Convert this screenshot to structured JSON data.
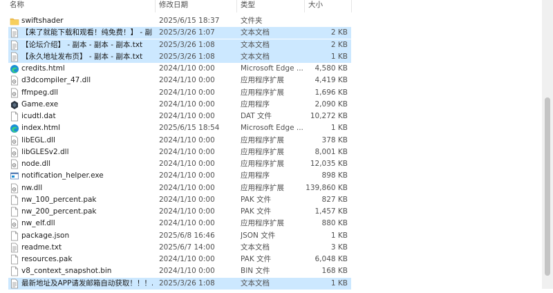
{
  "columns": {
    "name": "名称",
    "date": "修改日期",
    "type": "类型",
    "size": "大小"
  },
  "rows": [
    {
      "name": "swiftshader",
      "date": "2025/6/15 18:37",
      "type": "文件夹",
      "size": "",
      "icon": "folder-icon",
      "selected": false
    },
    {
      "name": "【来了就能下载和观看！纯免费！】 - 副...",
      "date": "2025/3/26 1:07",
      "type": "文本文档",
      "size": "2 KB",
      "icon": "text-file-icon",
      "selected": true
    },
    {
      "name": "【论坛介绍】 - 副本 - 副本 - 副本.txt",
      "date": "2025/3/26 1:08",
      "type": "文本文档",
      "size": "2 KB",
      "icon": "text-file-icon",
      "selected": true
    },
    {
      "name": "【永久地址发布页】 - 副本 - 副本.txt",
      "date": "2025/3/26 1:08",
      "type": "文本文档",
      "size": "1 KB",
      "icon": "text-file-icon",
      "selected": true
    },
    {
      "name": "credits.html",
      "date": "2024/1/10 0:00",
      "type": "Microsoft Edge ...",
      "size": "4,580 KB",
      "icon": "edge-icon",
      "selected": false
    },
    {
      "name": "d3dcompiler_47.dll",
      "date": "2024/1/10 0:00",
      "type": "应用程序扩展",
      "size": "4,419 KB",
      "icon": "dll-icon",
      "selected": false
    },
    {
      "name": "ffmpeg.dll",
      "date": "2024/1/10 0:00",
      "type": "应用程序扩展",
      "size": "1,696 KB",
      "icon": "dll-icon",
      "selected": false
    },
    {
      "name": "Game.exe",
      "date": "2024/1/10 0:00",
      "type": "应用程序",
      "size": "2,090 KB",
      "icon": "game-exe-icon",
      "selected": false
    },
    {
      "name": "icudtl.dat",
      "date": "2024/1/10 0:00",
      "type": "DAT 文件",
      "size": "10,272 KB",
      "icon": "file-icon",
      "selected": false
    },
    {
      "name": "index.html",
      "date": "2025/6/15 18:54",
      "type": "Microsoft Edge ...",
      "size": "1 KB",
      "icon": "edge-icon",
      "selected": false
    },
    {
      "name": "libEGL.dll",
      "date": "2024/1/10 0:00",
      "type": "应用程序扩展",
      "size": "378 KB",
      "icon": "dll-icon",
      "selected": false
    },
    {
      "name": "libGLESv2.dll",
      "date": "2024/1/10 0:00",
      "type": "应用程序扩展",
      "size": "8,001 KB",
      "icon": "dll-icon",
      "selected": false
    },
    {
      "name": "node.dll",
      "date": "2024/1/10 0:00",
      "type": "应用程序扩展",
      "size": "12,035 KB",
      "icon": "dll-icon",
      "selected": false
    },
    {
      "name": "notification_helper.exe",
      "date": "2024/1/10 0:00",
      "type": "应用程序",
      "size": "898 KB",
      "icon": "exe-window-icon",
      "selected": false
    },
    {
      "name": "nw.dll",
      "date": "2024/1/10 0:00",
      "type": "应用程序扩展",
      "size": "139,860 KB",
      "icon": "dll-icon",
      "selected": false
    },
    {
      "name": "nw_100_percent.pak",
      "date": "2024/1/10 0:00",
      "type": "PAK 文件",
      "size": "827 KB",
      "icon": "file-icon",
      "selected": false
    },
    {
      "name": "nw_200_percent.pak",
      "date": "2024/1/10 0:00",
      "type": "PAK 文件",
      "size": "1,457 KB",
      "icon": "file-icon",
      "selected": false
    },
    {
      "name": "nw_elf.dll",
      "date": "2024/1/10 0:00",
      "type": "应用程序扩展",
      "size": "880 KB",
      "icon": "dll-icon",
      "selected": false
    },
    {
      "name": "package.json",
      "date": "2025/6/8 16:46",
      "type": "JSON 文件",
      "size": "1 KB",
      "icon": "file-icon",
      "selected": false
    },
    {
      "name": "readme.txt",
      "date": "2025/6/7 14:00",
      "type": "文本文档",
      "size": "3 KB",
      "icon": "text-file-icon",
      "selected": false
    },
    {
      "name": "resources.pak",
      "date": "2024/1/10 0:00",
      "type": "PAK 文件",
      "size": "6,048 KB",
      "icon": "file-icon",
      "selected": false
    },
    {
      "name": "v8_context_snapshot.bin",
      "date": "2024/1/10 0:00",
      "type": "BIN 文件",
      "size": "168 KB",
      "icon": "file-icon",
      "selected": false
    },
    {
      "name": "最新地址及APP请发邮箱自动获取！！！...",
      "date": "2025/3/26 1:08",
      "type": "文本文档",
      "size": "1 KB",
      "icon": "text-file-icon",
      "selected": true
    }
  ],
  "colors": {
    "selection": "#cce8ff",
    "folder": "#f2c14e",
    "edge": "#1a8fd6"
  }
}
